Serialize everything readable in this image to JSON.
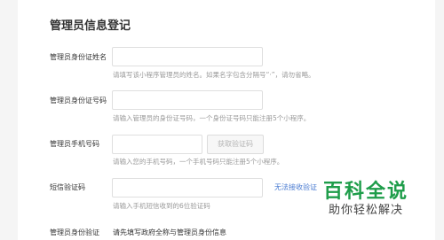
{
  "page_title": "管理员信息登记",
  "fields": {
    "name": {
      "label": "管理员身份证姓名",
      "value": "",
      "hint": "请填写该小程序管理员的姓名。如果名字包含分隔号“·”，请勿省略。"
    },
    "id_number": {
      "label": "管理员身份证号码",
      "value": "",
      "hint": "请输入管理员的身份证号码，一个身份证号码只能注册5个小程序。"
    },
    "phone": {
      "label": "管理员手机号码",
      "value": "",
      "hint": "请输入您的手机号码，一个手机号码只能注册5个小程序。",
      "get_code_button": "获取验证码"
    },
    "sms_code": {
      "label": "短信验证码",
      "value": "",
      "hint": "请输入手机短信收到的6位验证码",
      "cant_receive_link": "无法接收验证"
    },
    "identity_verify": {
      "label": "管理员身份验证",
      "note": "请先填写政府全称与管理员身份信息"
    }
  },
  "watermark": {
    "title": "百科全说",
    "subtitle": "助你轻松解决"
  }
}
